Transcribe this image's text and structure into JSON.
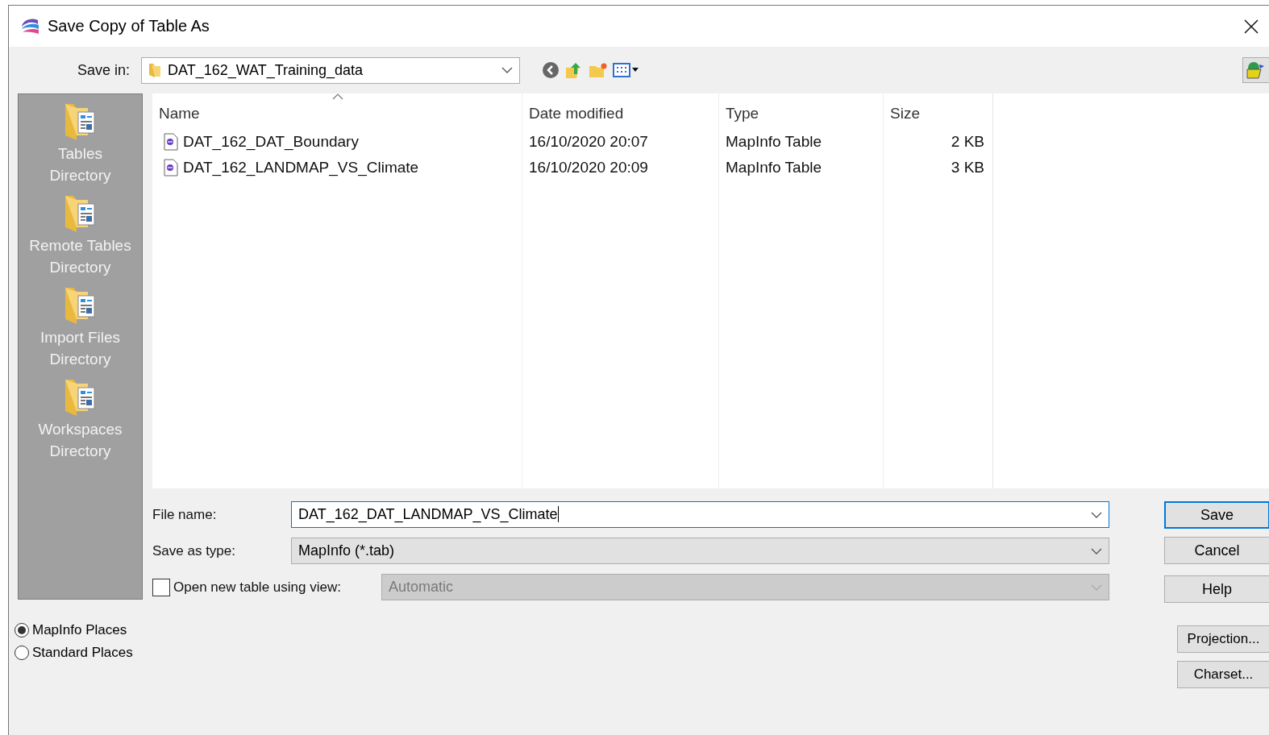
{
  "window": {
    "title": "Save Copy of Table As"
  },
  "save_in": {
    "label": "Save in:",
    "value": "DAT_162_WAT_Training_data"
  },
  "places": [
    {
      "label": "Tables Directory"
    },
    {
      "label": "Remote Tables Directory"
    },
    {
      "label": "Import Files Directory"
    },
    {
      "label": "Workspaces Directory"
    }
  ],
  "places_mode": [
    {
      "label": "MapInfo Places",
      "selected": true
    },
    {
      "label": "Standard Places",
      "selected": false
    }
  ],
  "file_list": {
    "columns": [
      {
        "label": "Name",
        "sorted": true
      },
      {
        "label": "Date modified",
        "sorted": false
      },
      {
        "label": "Type",
        "sorted": false
      },
      {
        "label": "Size",
        "sorted": false
      }
    ],
    "rows": [
      {
        "name": "DAT_162_DAT_Boundary",
        "date_modified": "16/10/2020 20:07",
        "type": "MapInfo Table",
        "size": "2 KB"
      },
      {
        "name": "DAT_162_LANDMAP_VS_Climate",
        "date_modified": "16/10/2020 20:09",
        "type": "MapInfo Table",
        "size": "3 KB"
      }
    ]
  },
  "file_name": {
    "label": "File name:",
    "value": "DAT_162_DAT_LANDMAP_VS_Climate"
  },
  "save_as_type": {
    "label": "Save as type:",
    "value": "MapInfo (*.tab)"
  },
  "open_view": {
    "label": "Open new table using view:",
    "checked": false,
    "value": "Automatic",
    "disabled": true
  },
  "buttons": [
    {
      "label": "Save",
      "default": true
    },
    {
      "label": "Cancel",
      "default": false
    },
    {
      "label": "Help",
      "default": false
    }
  ],
  "extra_buttons": [
    {
      "label": "Projection..."
    },
    {
      "label": "Charset..."
    }
  ]
}
